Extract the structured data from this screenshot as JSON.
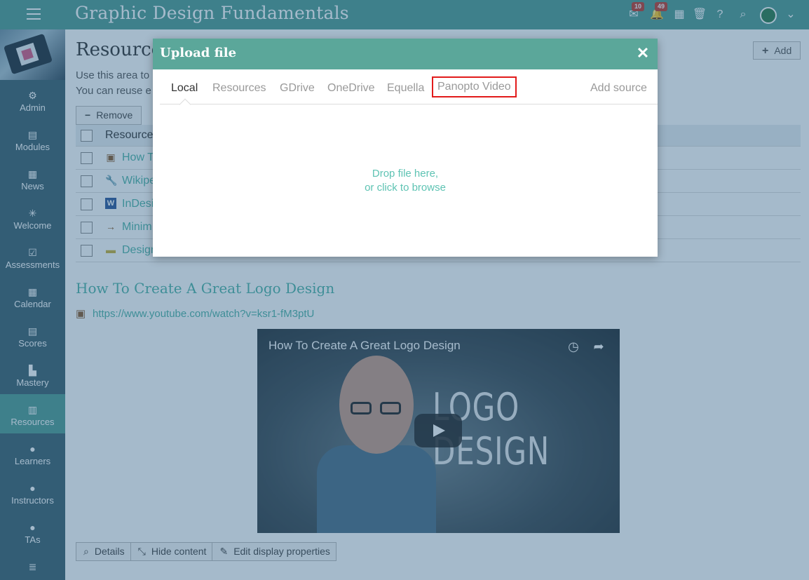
{
  "header": {
    "course_title": "Graphic Design Fundamentals",
    "messages_badge": "10",
    "notifications_badge": "49"
  },
  "sidebar": {
    "items": [
      {
        "label": "Admin",
        "icon": "gear-icon"
      },
      {
        "label": "Modules",
        "icon": "book-icon"
      },
      {
        "label": "News",
        "icon": "newspaper-icon"
      },
      {
        "label": "Welcome",
        "icon": "spinner-icon"
      },
      {
        "label": "Assessments",
        "icon": "checkbox-icon"
      },
      {
        "label": "Calendar",
        "icon": "calendar-icon"
      },
      {
        "label": "Scores",
        "icon": "scores-icon"
      },
      {
        "label": "Mastery",
        "icon": "bar-chart-icon"
      },
      {
        "label": "Resources",
        "icon": "books-icon",
        "active": true
      },
      {
        "label": "Learners",
        "icon": "user-icon"
      },
      {
        "label": "Instructors",
        "icon": "user-icon"
      },
      {
        "label": "TAs",
        "icon": "user-icon"
      },
      {
        "label": "",
        "icon": "list-icon"
      }
    ]
  },
  "main": {
    "page_title": "Resource",
    "intro_line1": "Use this area to",
    "intro_line2": "You can reuse e",
    "add_label": "Add",
    "remove_label": "Remove",
    "table": {
      "header": "Resource",
      "rows": [
        {
          "label": "How T",
          "icon": "film-icon",
          "color": "#8a5a2b"
        },
        {
          "label": "Wikipe",
          "icon": "wrench-icon",
          "color": "#3aa23a"
        },
        {
          "label": "InDesi",
          "icon": "word-icon",
          "color": "#2b579a"
        },
        {
          "label": "Minim",
          "icon": "arrow-right-icon",
          "color": "#8a5a2b"
        },
        {
          "label": "Design",
          "icon": "folder-icon",
          "color": "#c9b037"
        }
      ]
    },
    "section_title": "How To Create A Great Logo Design",
    "url": "https://www.youtube.com/watch?v=ksr1-fM3ptU",
    "video": {
      "title": "How To Create A Great Logo Design",
      "overlay_text": "LOGO DESIGN"
    },
    "toolbar": {
      "details": "Details",
      "hide_content": "Hide content",
      "edit_display": "Edit display properties"
    }
  },
  "modal": {
    "title": "Upload file",
    "tabs": [
      "Local",
      "Resources",
      "GDrive",
      "OneDrive",
      "Equella",
      "Panopto Video"
    ],
    "active_tab": "Local",
    "highlighted_tab": "Panopto Video",
    "add_source": "Add source",
    "drop_line1": "Drop file here,",
    "drop_line2": "or click to browse"
  },
  "colors": {
    "header": "#4f9b91",
    "sidebar": "#3c5f6c",
    "accent": "#4fb3a6",
    "highlight_border": "#e21b1b"
  }
}
